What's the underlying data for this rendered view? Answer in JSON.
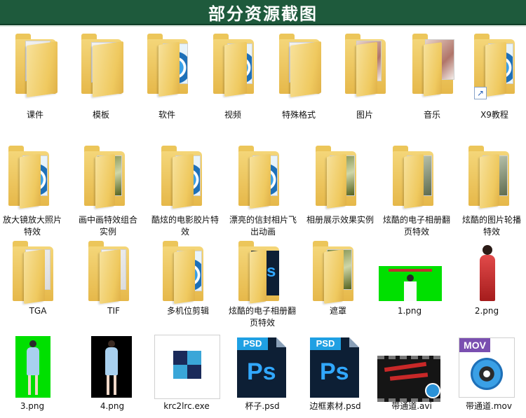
{
  "banner": {
    "title": "部分资源截图"
  },
  "folders_row1": [
    {
      "label": "课件"
    },
    {
      "label": "模板"
    },
    {
      "label": "软件"
    },
    {
      "label": "视频"
    },
    {
      "label": "特殊格式"
    },
    {
      "label": "图片"
    },
    {
      "label": "音乐"
    },
    {
      "label": "X9教程"
    }
  ],
  "folders_row2": [
    {
      "label": "放大镜放大照片特效"
    },
    {
      "label": "画中画特效组合实例"
    },
    {
      "label": "酷炫的电影胶片特效"
    },
    {
      "label": "漂亮的信封相片飞出动画"
    },
    {
      "label": "相册展示效果实例"
    },
    {
      "label": "炫酷的电子相册翻页特效"
    },
    {
      "label": "炫酷的图片轮播特效"
    }
  ],
  "row3": [
    {
      "label": "TGA"
    },
    {
      "label": "TIF"
    },
    {
      "label": "多机位剪辑"
    },
    {
      "label": "炫酷的电子相册翻页特效"
    },
    {
      "label": "遮罩"
    },
    {
      "label": "1.png"
    },
    {
      "label": "2.png"
    }
  ],
  "row4": [
    {
      "label": "3.png"
    },
    {
      "label": "4.png"
    },
    {
      "label": "krc2lrc.exe"
    },
    {
      "label": "杯子.psd"
    },
    {
      "label": "边框素材.psd"
    },
    {
      "label": "带通道.avi"
    },
    {
      "label": "带通道.mov"
    }
  ],
  "file_badges": {
    "psd": "PSD",
    "ps": "Ps",
    "mov": "MOV"
  },
  "colors": {
    "banner": "#1e5a3c",
    "folder": "#efc95f",
    "green_screen": "#00e000"
  }
}
